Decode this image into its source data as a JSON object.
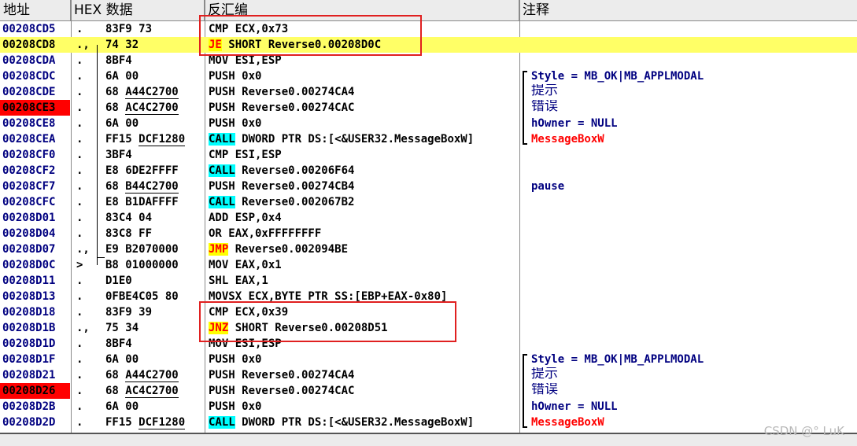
{
  "header": {
    "address": "地址",
    "hex": "HEX 数据",
    "disasm": "反汇编",
    "comment": "注释"
  },
  "rows": [
    {
      "addr": "00208CD5",
      "mark": ".",
      "hex": "83F9 73",
      "disasm": "CMP ECX,0x73",
      "comment": ""
    },
    {
      "addr": "00208CD8",
      "mark": ".,",
      "hex": "74 32",
      "disasm_pre": "JE",
      "disasm_post": " SHORT Reverse0.00208D0C",
      "comment": ""
    },
    {
      "addr": "00208CDA",
      "mark": ".",
      "hex": "8BF4",
      "disasm": "MOV ESI,ESP",
      "comment": ""
    },
    {
      "addr": "00208CDC",
      "mark": ".",
      "hex": "6A 00",
      "disasm": "PUSH 0x0",
      "comment": "Style = MB_OK|MB_APPLMODAL"
    },
    {
      "addr": "00208CDE",
      "mark": ".",
      "hex_pre": "68 ",
      "hex_ul": "A44C2700",
      "disasm": "PUSH Reverse0.00274CA4",
      "comment": "提示"
    },
    {
      "addr": "00208CE3",
      "mark": ".",
      "hex_pre": "68 ",
      "hex_ul": "AC4C2700",
      "disasm": "PUSH Reverse0.00274CAC",
      "comment": "错误"
    },
    {
      "addr": "00208CE8",
      "mark": ".",
      "hex": "6A 00",
      "disasm": "PUSH 0x0",
      "comment": "hOwner = NULL"
    },
    {
      "addr": "00208CEA",
      "mark": ".",
      "hex_pre": "FF15 ",
      "hex_ul": "DCF1280",
      "disasm_pre": "CALL",
      "disasm_post": " DWORD PTR DS:[<&USER32.MessageBoxW]",
      "comment": "MessageBoxW"
    },
    {
      "addr": "00208CF0",
      "mark": ".",
      "hex": "3BF4",
      "disasm": "CMP ESI,ESP",
      "comment": ""
    },
    {
      "addr": "00208CF2",
      "mark": ".",
      "hex": "E8 6DE2FFFF",
      "disasm_pre": "CALL",
      "disasm_post": " Reverse0.00206F64",
      "comment": ""
    },
    {
      "addr": "00208CF7",
      "mark": ".",
      "hex_pre": "68 ",
      "hex_ul": "B44C2700",
      "disasm": "PUSH Reverse0.00274CB4",
      "comment": "pause"
    },
    {
      "addr": "00208CFC",
      "mark": ".",
      "hex": "E8 B1DAFFFF",
      "disasm_pre": "CALL",
      "disasm_post": " Reverse0.002067B2",
      "comment": ""
    },
    {
      "addr": "00208D01",
      "mark": ".",
      "hex": "83C4 04",
      "disasm": "ADD ESP,0x4",
      "comment": ""
    },
    {
      "addr": "00208D04",
      "mark": ".",
      "hex": "83C8 FF",
      "disasm": "OR EAX,0xFFFFFFFF",
      "comment": ""
    },
    {
      "addr": "00208D07",
      "mark": ".,",
      "hex": "E9 B2070000",
      "disasm_pre": "JMP",
      "disasm_post": " Reverse0.002094BE",
      "comment": ""
    },
    {
      "addr": "00208D0C",
      "mark": ">",
      "hex": "B8 01000000",
      "disasm": "MOV EAX,0x1",
      "comment": ""
    },
    {
      "addr": "00208D11",
      "mark": ".",
      "hex": "D1E0",
      "disasm": "SHL EAX,1",
      "comment": ""
    },
    {
      "addr": "00208D13",
      "mark": ".",
      "hex": "0FBE4C05 80",
      "disasm": "MOVSX ECX,BYTE PTR SS:[EBP+EAX-0x80]",
      "comment": ""
    },
    {
      "addr": "00208D18",
      "mark": ".",
      "hex": "83F9 39",
      "disasm": "CMP ECX,0x39",
      "comment": ""
    },
    {
      "addr": "00208D1B",
      "mark": ".,",
      "hex": "75 34",
      "disasm_pre": "JNZ",
      "disasm_post": " SHORT Reverse0.00208D51",
      "comment": ""
    },
    {
      "addr": "00208D1D",
      "mark": ".",
      "hex": "8BF4",
      "disasm": "MOV ESI,ESP",
      "comment": ""
    },
    {
      "addr": "00208D1F",
      "mark": ".",
      "hex": "6A 00",
      "disasm": "PUSH 0x0",
      "comment": "Style = MB_OK|MB_APPLMODAL"
    },
    {
      "addr": "00208D21",
      "mark": ".",
      "hex_pre": "68 ",
      "hex_ul": "A44C2700",
      "disasm": "PUSH Reverse0.00274CA4",
      "comment": "提示"
    },
    {
      "addr": "00208D26",
      "mark": ".",
      "hex_pre": "68 ",
      "hex_ul": "AC4C2700",
      "disasm": "PUSH Reverse0.00274CAC",
      "comment": "错误"
    },
    {
      "addr": "00208D2B",
      "mark": ".",
      "hex": "6A 00",
      "disasm": "PUSH 0x0",
      "comment": "hOwner = NULL"
    },
    {
      "addr": "00208D2D",
      "mark": ".",
      "hex_pre": "FF15 ",
      "hex_ul": "DCF1280",
      "disasm_pre": "CALL",
      "disasm_post": " DWORD PTR DS:[<&USER32.MessageBoxW]",
      "comment": "MessageBoxW"
    }
  ],
  "watermark": "CSDN @° LuK",
  "colors": {
    "selected_row": "#ffff66",
    "highlight_address": "#ff0000",
    "jump_mnemonic_bg": "#ffff00",
    "call_mnemonic_bg": "#00ffff",
    "annotation_box": "#e02020"
  }
}
